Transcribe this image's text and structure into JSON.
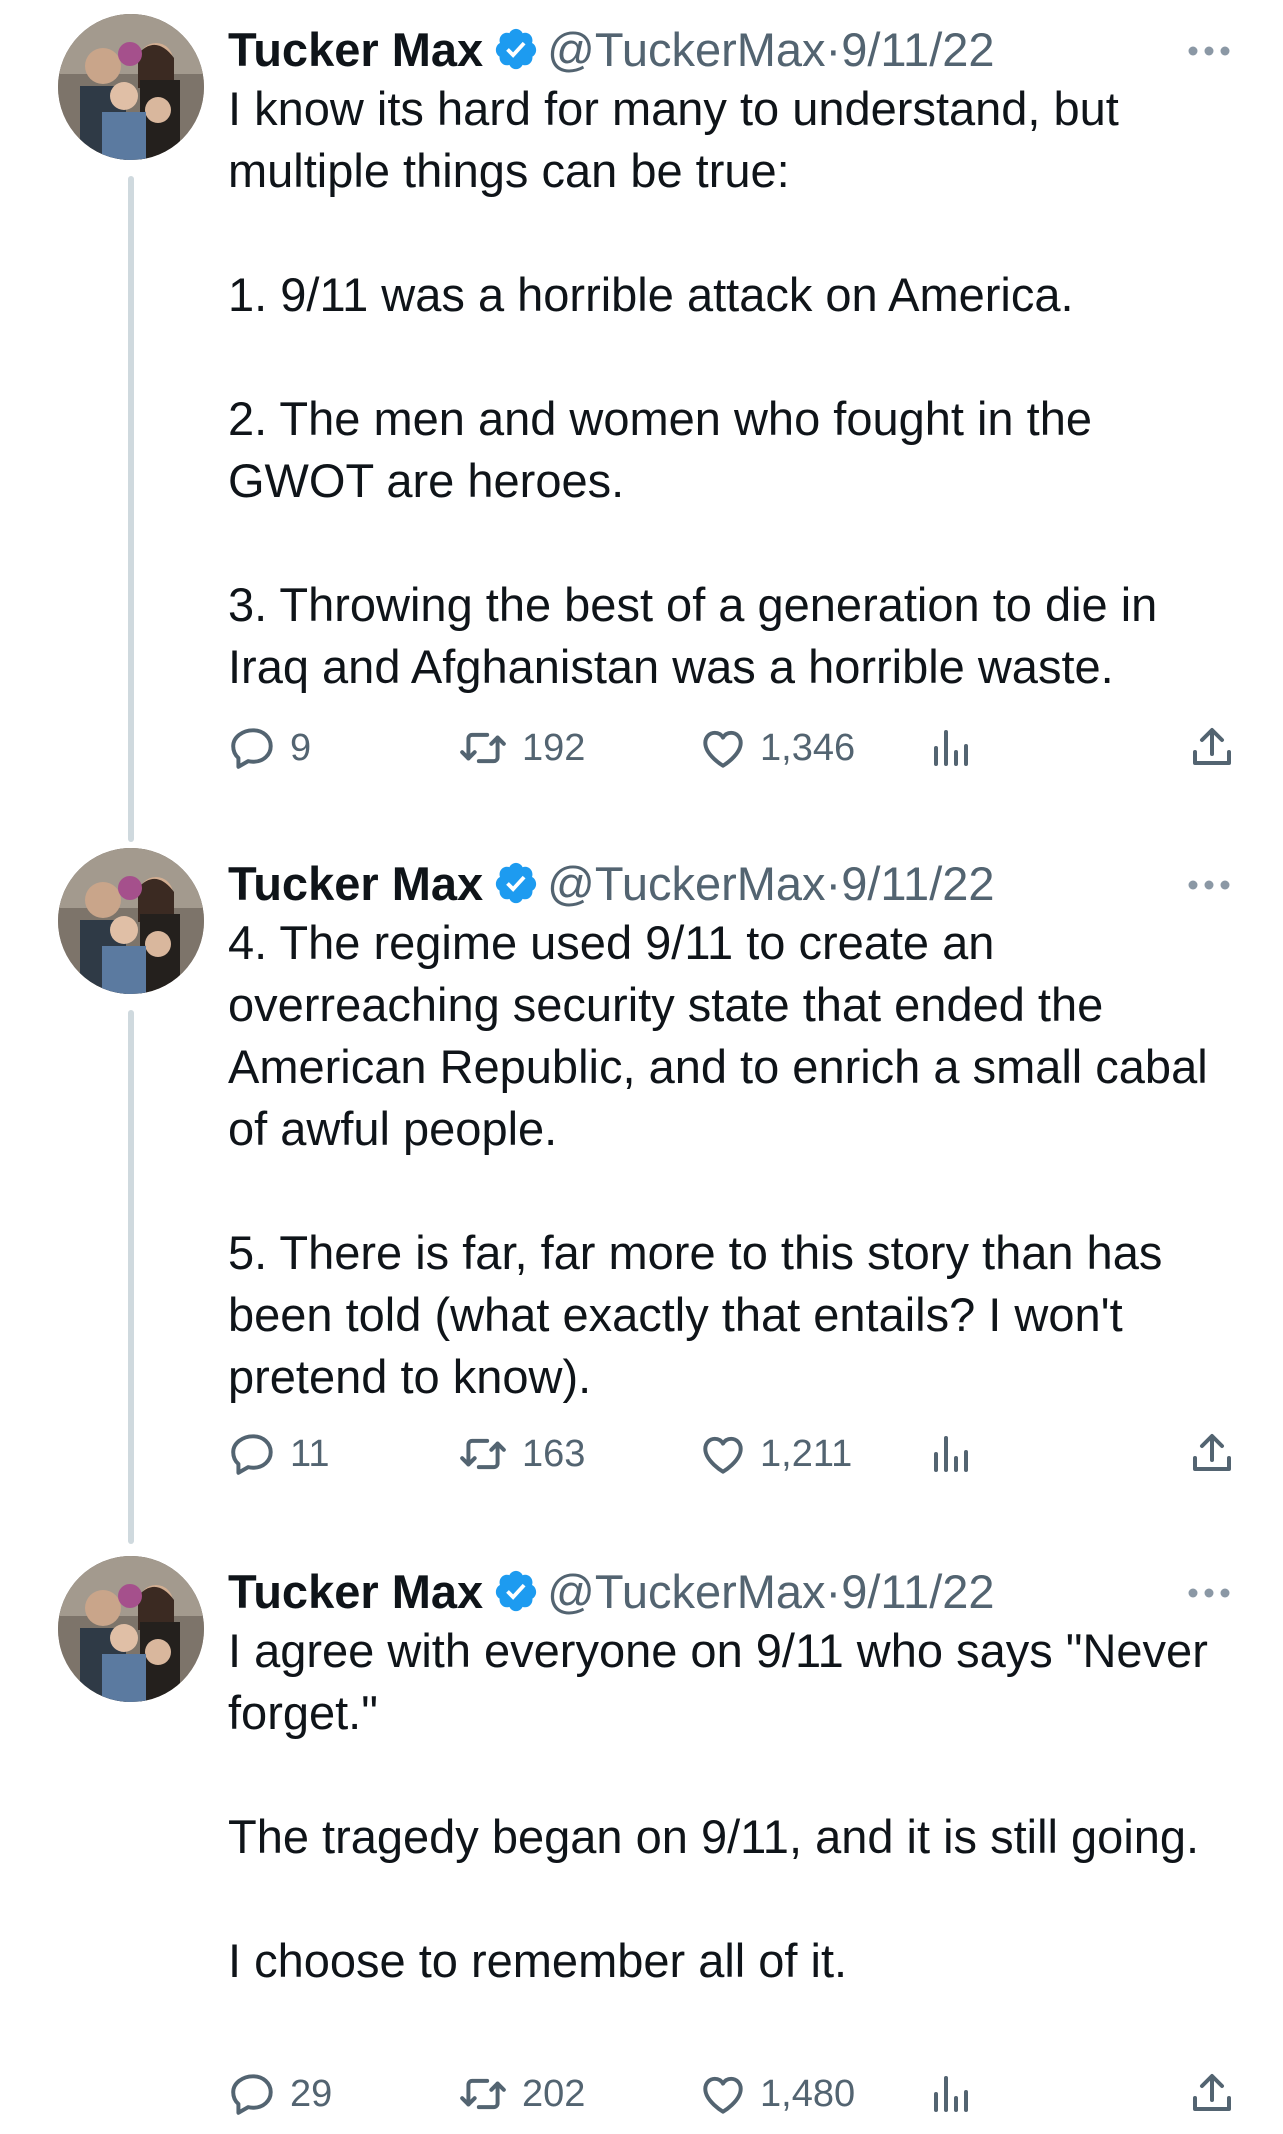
{
  "tweets": [
    {
      "name": "Tucker Max",
      "handle": "@TuckerMax",
      "separator": "·",
      "date": "9/11/22",
      "text": "I know its hard for many to understand, but multiple things can be true:\n\n1. 9/11 was a horrible attack on America.\n\n2. The men and women who fought in the GWOT are heroes.\n\n3. Throwing the best of a generation to die in Iraq and Afghanistan was a horrible waste.",
      "replies": "9",
      "retweets": "192",
      "likes": "1,346"
    },
    {
      "name": "Tucker Max",
      "handle": "@TuckerMax",
      "separator": "·",
      "date": "9/11/22",
      "text": "4. The regime used 9/11 to create an overreaching security state that ended the American Republic, and to enrich a small cabal of awful people.\n\n5. There is far, far more to this story than has been told (what exactly that entails? I won't pretend to know).",
      "replies": "11",
      "retweets": "163",
      "likes": "1,211"
    },
    {
      "name": "Tucker Max",
      "handle": "@TuckerMax",
      "separator": "·",
      "date": "9/11/22",
      "text": "I agree with everyone on 9/11 who says \"Never forget.\"\n\nThe tragedy began on 9/11, and it is still going.\n\nI choose to remember all of it.",
      "replies": "29",
      "retweets": "202",
      "likes": "1,480"
    }
  ],
  "icons": {
    "verified": "verified-badge-icon",
    "more": "more-dots-icon",
    "reply": "reply-bubble-icon",
    "retweet": "retweet-icon",
    "like": "heart-icon",
    "views": "views-bars-icon",
    "share": "share-upload-icon"
  },
  "colors": {
    "text": "#0f1419",
    "secondary": "#536471",
    "verified": "#1d9bf0",
    "thread_line": "#cfd9de"
  }
}
